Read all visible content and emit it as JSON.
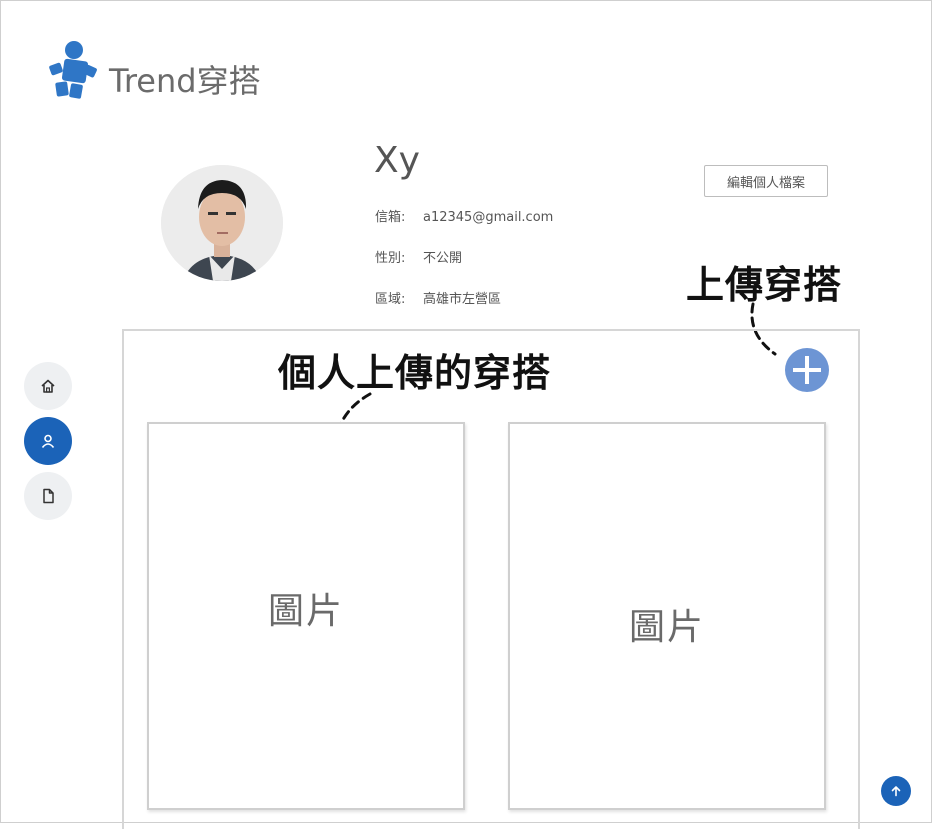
{
  "app": {
    "title": "Trend穿搭"
  },
  "profile": {
    "username": "Xy",
    "email_label": "信箱:",
    "email": "a12345@gmail.com",
    "gender_label": "性別:",
    "gender": "不公開",
    "area_label": "區域:",
    "area": "高雄市左營區",
    "edit_button": "編輯個人檔案"
  },
  "annotations": {
    "upload": "上傳穿搭",
    "personal": "個人上傳的穿搭"
  },
  "nav": {
    "items": [
      {
        "icon": "home-icon",
        "active": false
      },
      {
        "icon": "user-icon",
        "active": true
      },
      {
        "icon": "file-icon",
        "active": false
      }
    ]
  },
  "gallery": {
    "cards": [
      {
        "label": "圖片"
      },
      {
        "label": "圖片"
      }
    ]
  },
  "colors": {
    "primary": "#1b63b8",
    "add_button": "#6d95d4",
    "logo": "#2f76c6"
  }
}
